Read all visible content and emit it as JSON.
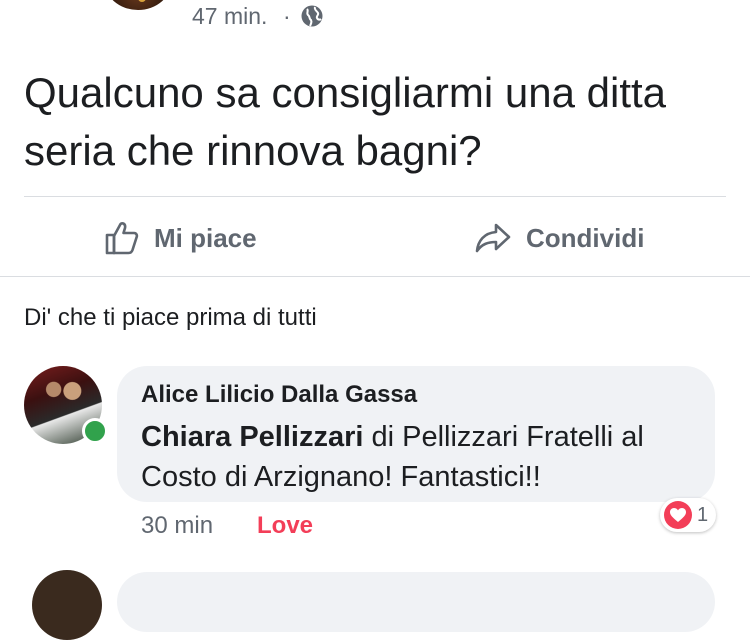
{
  "post": {
    "time": "47 min.",
    "separator": "·",
    "privacy_icon": "globe-icon",
    "text": "Qualcuno sa consigliarmi una ditta seria che rinnova bagni?"
  },
  "actions": {
    "like_label": "Mi piace",
    "like_icon": "thumbs-up-icon",
    "share_label": "Condividi",
    "share_icon": "share-arrow-icon"
  },
  "reactions_prompt": "Di' che ti piace prima di tutti",
  "comment": {
    "author": "Alice Lilicio Dalla Gassa",
    "mention": "Chiara Pellizzari",
    "text_rest": " di Pellizzari Fratelli al Costo di Arzignano! Fantastici!!",
    "time": "30 min",
    "reaction_label": "Love",
    "reaction_count": "1",
    "online": true
  },
  "colors": {
    "love": "#f33e58",
    "online": "#31a24c",
    "bubble": "#f0f2f5",
    "secondary_text": "#606770"
  }
}
